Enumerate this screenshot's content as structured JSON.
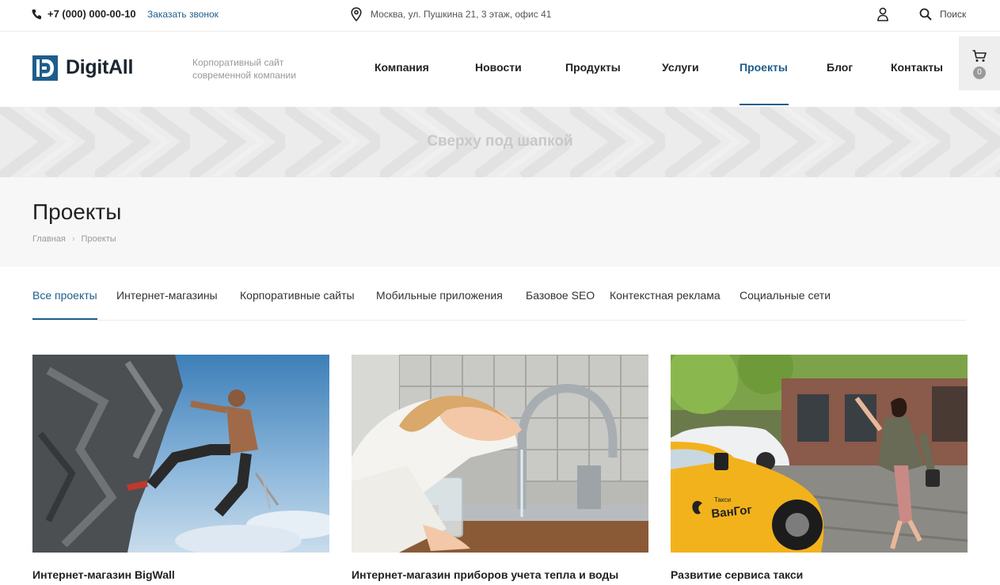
{
  "topbar": {
    "phone": "+7 (000) 000-00-10",
    "callback": "Заказать звонок",
    "address": "Москва, ул. Пушкина 21, 3 этаж, офис 41",
    "search_label": "Поиск",
    "icons": [
      "phone-icon",
      "map-pin-icon",
      "user-icon",
      "search-icon"
    ]
  },
  "header": {
    "logo_text": "DigitAll",
    "tagline": "Корпоративный сайт современной компании",
    "nav": [
      {
        "label": "Компания"
      },
      {
        "label": "Новости"
      },
      {
        "label": "Продукты"
      },
      {
        "label": "Услуги"
      },
      {
        "label": "Проекты",
        "active": true
      },
      {
        "label": "Блог"
      },
      {
        "label": "Контакты"
      }
    ],
    "cart_count": "0"
  },
  "banner": {
    "text": "Сверху под шапкой"
  },
  "page": {
    "title": "Проекты",
    "breadcrumb": [
      "Главная",
      "Проекты"
    ]
  },
  "tabs": [
    {
      "label": "Все проекты",
      "active": true
    },
    {
      "label": "Интернет-магазины"
    },
    {
      "label": "Корпоративные сайты"
    },
    {
      "label": "Мобильные приложения"
    },
    {
      "label": "Базовое SEO"
    },
    {
      "label": "Контекстная реклама"
    },
    {
      "label": "Социальные сети"
    }
  ],
  "projects": [
    {
      "title": "Интернет-магазин BigWall"
    },
    {
      "title": "Интернет-магазин приборов учета тепла и воды"
    },
    {
      "title": "Развитие сервиса такси",
      "taxi_brand": "ВанГог",
      "taxi_sign": "Такси"
    }
  ],
  "colors": {
    "accent": "#1e5d8c",
    "text_dark": "#222222",
    "muted": "#999999",
    "banner_bg": "#ececec",
    "page_head_bg": "#f7f7f7"
  }
}
